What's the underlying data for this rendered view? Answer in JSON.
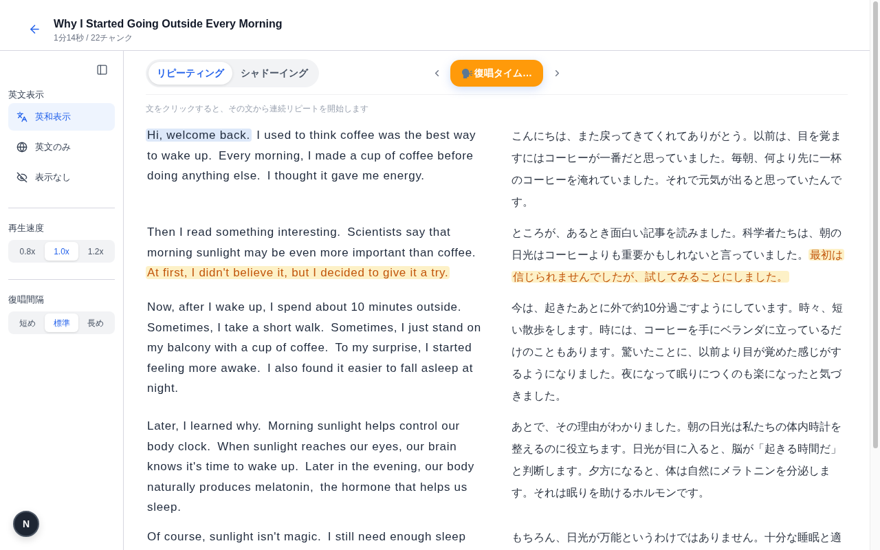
{
  "header": {
    "title": "Why I Started Going Outside Every Morning",
    "subtitle": "1分14秒 / 22チャンク"
  },
  "sidebar": {
    "sections": [
      {
        "kind": "list",
        "label": "英文表示",
        "options": [
          {
            "label": "英和表示",
            "selected": true
          },
          {
            "label": "英文のみ",
            "selected": false
          },
          {
            "label": "表示なし",
            "selected": false
          }
        ]
      },
      {
        "kind": "segmented",
        "label": "再生速度",
        "options": [
          {
            "label": "0.8x",
            "selected": false
          },
          {
            "label": "1.0x",
            "selected": true
          },
          {
            "label": "1.2x",
            "selected": false
          }
        ]
      },
      {
        "kind": "segmented",
        "label": "復唱間隔",
        "options": [
          {
            "label": "短め",
            "selected": false
          },
          {
            "label": "標準",
            "selected": true
          },
          {
            "label": "長め",
            "selected": false
          }
        ]
      }
    ]
  },
  "mode_tabs": [
    {
      "label": "リピーティング",
      "selected": true
    },
    {
      "label": "シャドーイング",
      "selected": false
    }
  ],
  "chunk_button": {
    "label": "復唱タイム…"
  },
  "hint": "文をクリックすると、その文から連続リピートを開始します",
  "paragraphs": [
    {
      "english": [
        {
          "text": "Hi, welcome back.",
          "selected": true,
          "playing": false
        },
        {
          "text": "I used to think coffee was the best way to wake up.",
          "selected": false,
          "playing": false
        },
        {
          "text": "Every morning, I made a cup of coffee before doing anything else.",
          "selected": false,
          "playing": false
        },
        {
          "text": "I thought it gave me energy.",
          "selected": false,
          "playing": false
        }
      ],
      "japanese": [
        {
          "text": "こんにちは、また戻ってきてくれてありがとう。以前は、目を覚ますにはコーヒーが一番だと思っていました。毎朝、何より先に一杯のコーヒーを淹れていました。それで元気が出ると思っていたんです。",
          "playing": false
        }
      ]
    },
    {
      "english": [
        {
          "text": "Then I read something interesting.",
          "selected": false,
          "playing": false
        },
        {
          "text": "Scientists say that morning sunlight may be even more important than coffee.",
          "selected": false,
          "playing": false
        },
        {
          "text": "At first, I didn't believe it, but I decided to give it a try.",
          "selected": false,
          "playing": true
        }
      ],
      "japanese": [
        {
          "text": "ところが、あるとき面白い記事を読みました。科学者たちは、朝の日光はコーヒーよりも重要かもしれないと言っていました。",
          "playing": false
        },
        {
          "text": "最初は信じられませんでしたが、試してみることにしました。",
          "playing": true
        }
      ]
    },
    {
      "english": [
        {
          "text": "Now, after I wake up, I spend about 10 minutes outside.",
          "selected": false,
          "playing": false
        },
        {
          "text": "Sometimes, I take a short walk.",
          "selected": false,
          "playing": false
        },
        {
          "text": "Sometimes, I just stand on my balcony with a cup of coffee.",
          "selected": false,
          "playing": false
        },
        {
          "text": "To my surprise, I started feeling more awake.",
          "selected": false,
          "playing": false
        },
        {
          "text": "I also found it easier to fall asleep at night.",
          "selected": false,
          "playing": false
        }
      ],
      "japanese": [
        {
          "text": "今は、起きたあとに外で約10分過ごすようにしています。時々、短い散歩をします。時には、コーヒーを手にベランダに立っているだけのこともあります。驚いたことに、以前より目が覚めた感じがするようになりました。夜になって眠りにつくのも楽になったと気づきました。",
          "playing": false
        }
      ]
    },
    {
      "english": [
        {
          "text": "Later, I learned why.",
          "selected": false,
          "playing": false
        },
        {
          "text": "Morning sunlight helps control our body clock.",
          "selected": false,
          "playing": false
        },
        {
          "text": "When sunlight reaches our eyes, our brain knows it's time to wake up.",
          "selected": false,
          "playing": false
        },
        {
          "text": "Later in the evening, our body naturally produces melatonin,",
          "selected": false,
          "playing": false
        },
        {
          "text": "the hormone that helps us sleep.",
          "selected": false,
          "playing": false
        }
      ],
      "japanese": [
        {
          "text": "あとで、その理由がわかりました。朝の日光は私たちの体内時計を整えるのに役立ちます。日光が目に入ると、脳が「起きる時間だ」と判断します。夕方になると、体は自然にメラトニンを分泌します。それは眠りを助けるホルモンです。",
          "playing": false
        }
      ]
    },
    {
      "english": [
        {
          "text": "Of course, sunlight isn't magic.",
          "selected": false,
          "playing": false
        },
        {
          "text": "I still need enough sleep",
          "selected": false,
          "playing": false
        }
      ],
      "japanese": [
        {
          "text": "もちろん、日光が万能というわけではありません。十分な睡眠と適",
          "playing": false
        }
      ]
    }
  ],
  "dev_badge": {
    "label": "N"
  }
}
